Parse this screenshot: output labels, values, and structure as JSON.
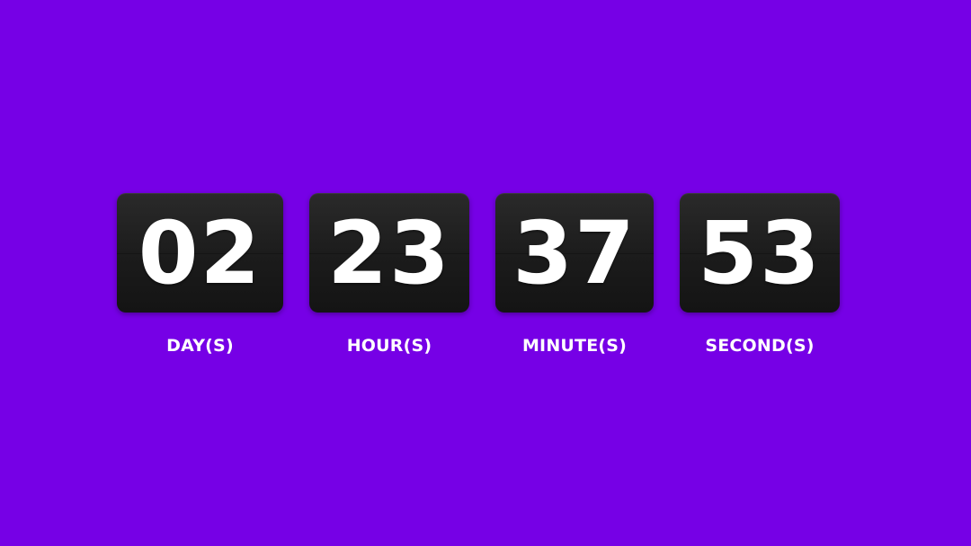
{
  "theme": {
    "background": "#7600e6",
    "tile": "#1c1c1c",
    "text": "#ffffff"
  },
  "countdown": {
    "days": {
      "value": "02",
      "label": "DAY(S)"
    },
    "hours": {
      "value": "23",
      "label": "HOUR(S)"
    },
    "minutes": {
      "value": "37",
      "label": "MINUTE(S)"
    },
    "seconds": {
      "value": "53",
      "label": "SECOND(S)"
    }
  }
}
